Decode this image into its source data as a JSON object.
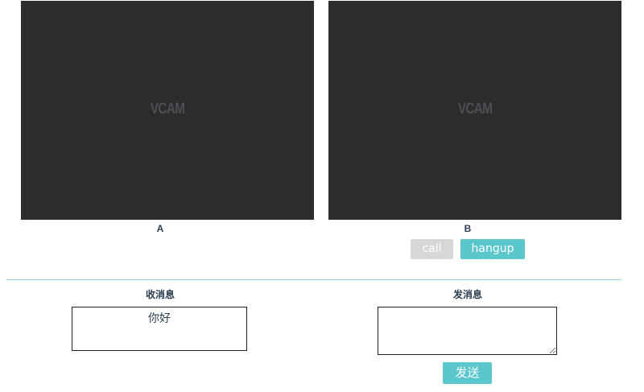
{
  "videos": {
    "a": {
      "label": "A",
      "placeholder": "VCAM"
    },
    "b": {
      "label": "B",
      "placeholder": "VCAM"
    }
  },
  "call_controls": {
    "call_label": "call",
    "hangup_label": "hangup"
  },
  "receive": {
    "title": "收消息",
    "content": "你好"
  },
  "send": {
    "title": "发消息",
    "value": "",
    "button_label": "发送"
  },
  "colors": {
    "accent": "#5bc6cc",
    "disabled": "#d7d7d7",
    "video_bg": "#2c2b2e",
    "divider": "#8fd7db"
  }
}
